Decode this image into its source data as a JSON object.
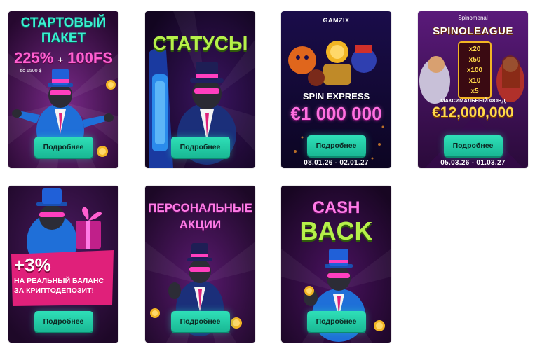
{
  "cards": [
    {
      "name": "starter-pack",
      "title_line1": "СТАРТОВЫЙ",
      "title_line2": "ПАКЕТ",
      "offer_main": "225%",
      "offer_plus": "+",
      "offer_fs": "100FS",
      "offer_sub": "до 1500 $",
      "button": "Подробнее",
      "colors": {
        "bg": "#3a0f4a",
        "title": "#38f0d0",
        "offer": "#ff5fd0"
      }
    },
    {
      "name": "statuses",
      "title": "СТАТУСЫ",
      "button": "Подробнее",
      "colors": {
        "bg": "#1c0a2e",
        "title": "#b6f04a"
      }
    },
    {
      "name": "spin-express",
      "provider": "GAMZIX",
      "game": "SPIN EXPRESS",
      "prize": "€1 000 000",
      "button": "Подробнее",
      "dates": "08.01.26 - 02.01.27",
      "colors": {
        "bg": "#150a3a",
        "prize": "#ff6fe0"
      }
    },
    {
      "name": "spinoleague",
      "provider": "Spinomenal",
      "game": "SPINOLEAGUE",
      "multipliers": [
        "x20",
        "x50",
        "x100",
        "x10",
        "x5"
      ],
      "fund_label": "МАКСИМАЛЬНЫЙ ФОНД",
      "prize": "€12,000,000",
      "button": "Подробнее",
      "dates": "05.03.26 - 01.03.27",
      "colors": {
        "bg": "#4a1266",
        "prize": "#ffd94a"
      }
    },
    {
      "name": "crypto-deposit",
      "percent": "+3%",
      "line1": "НА РЕАЛЬНЫЙ БАЛАНС",
      "line2": "ЗА КРИПТОДЕПОЗИТ!",
      "button": "Подробнее",
      "colors": {
        "bg": "#2a0c3c",
        "banner": "#e0207a"
      }
    },
    {
      "name": "personal-promos",
      "title_line1": "ПЕРСОНАЛЬНЫЕ",
      "title_line2": "АКЦИИ",
      "button": "Подробнее",
      "colors": {
        "bg": "#2a0a36",
        "title": "#ff7be6"
      }
    },
    {
      "name": "cashback",
      "title_line1": "CASH",
      "title_line2": "BACK",
      "button": "Подробнее",
      "colors": {
        "bg": "#220a30",
        "title": "#ff7be6",
        "title2": "#b6f04a"
      }
    }
  ]
}
